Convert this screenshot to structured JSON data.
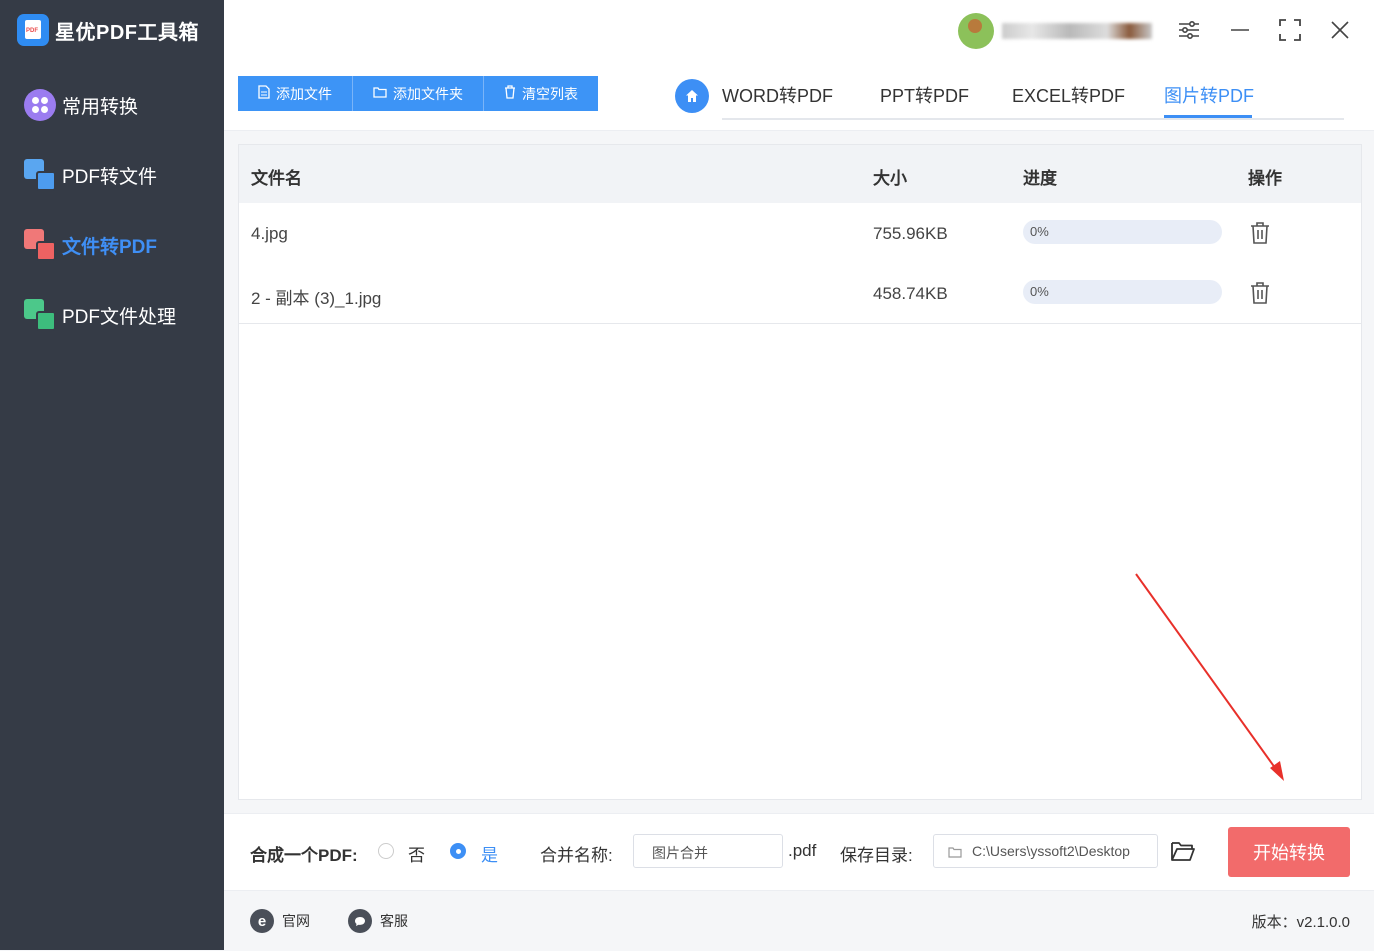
{
  "app": {
    "title": "星优PDF工具箱",
    "logo_text": "PDF"
  },
  "sidebar": {
    "items": [
      {
        "label": "常用转换",
        "active": false
      },
      {
        "label": "PDF转文件",
        "active": false
      },
      {
        "label": "文件转PDF",
        "active": true
      },
      {
        "label": "PDF文件处理",
        "active": false
      }
    ]
  },
  "toolbar": {
    "add_file": "添加文件",
    "add_folder": "添加文件夹",
    "clear_list": "清空列表"
  },
  "tabs": [
    {
      "label": "WORD转PDF",
      "active": false
    },
    {
      "label": "PPT转PDF",
      "active": false
    },
    {
      "label": "EXCEL转PDF",
      "active": false
    },
    {
      "label": "图片转PDF",
      "active": true
    }
  ],
  "table": {
    "headers": {
      "name": "文件名",
      "size": "大小",
      "progress": "进度",
      "action": "操作"
    },
    "rows": [
      {
        "name": "4.jpg",
        "size": "755.96KB",
        "progress_label": "0%",
        "progress": 0
      },
      {
        "name": "2 - 副本 (3)_1.jpg",
        "size": "458.74KB",
        "progress_label": "0%",
        "progress": 0
      }
    ]
  },
  "bottom": {
    "merge_label": "合成一个PDF:",
    "no_label": "否",
    "yes_label": "是",
    "merge_selected": "是",
    "merge_name_label": "合并名称:",
    "merge_name_value": "图片合并",
    "ext": ".pdf",
    "save_dir_label": "保存目录:",
    "save_dir_value": "C:\\Users\\yssoft2\\Desktop",
    "start_button": "开始转换"
  },
  "footer": {
    "website": "官网",
    "service": "客服",
    "version": "版本：v2.1.0.0"
  },
  "colors": {
    "accent": "#3d8ff5",
    "start": "#f26b6b",
    "sidebar": "#353b46",
    "annotation": "#e8302a"
  }
}
